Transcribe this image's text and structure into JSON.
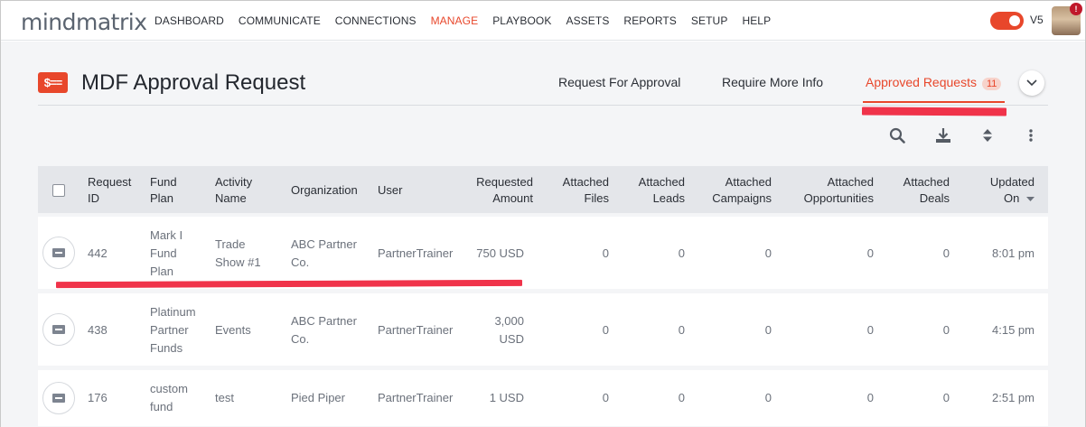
{
  "brand": {
    "logo_text": "mindmatrix"
  },
  "nav": {
    "items": [
      {
        "label": "DASHBOARD"
      },
      {
        "label": "COMMUNICATE"
      },
      {
        "label": "CONNECTIONS"
      },
      {
        "label": "MANAGE"
      },
      {
        "label": "PLAYBOOK"
      },
      {
        "label": "ASSETS"
      },
      {
        "label": "REPORTS"
      },
      {
        "label": "SETUP"
      },
      {
        "label": "HELP"
      }
    ],
    "active": "MANAGE",
    "version": "V5",
    "notification_count": "!"
  },
  "page": {
    "icon_text": "$==",
    "title": "MDF Approval Request"
  },
  "tabs": [
    {
      "label": "Request For Approval"
    },
    {
      "label": "Require More Info"
    },
    {
      "label": "Approved Requests",
      "count": "11"
    }
  ],
  "toolbar": {
    "icons": [
      "search-icon",
      "download-icon",
      "sort-icon",
      "more-vertical-icon"
    ]
  },
  "table": {
    "columns": [
      {
        "l1": "Request",
        "l2": "ID"
      },
      {
        "l1": "Fund",
        "l2": "Plan"
      },
      {
        "l1": "Activity",
        "l2": "Name"
      },
      {
        "l1": "Organization",
        "l2": ""
      },
      {
        "l1": "User",
        "l2": ""
      },
      {
        "l1": "Requested",
        "l2": "Amount"
      },
      {
        "l1": "Attached",
        "l2": "Files"
      },
      {
        "l1": "Attached",
        "l2": "Leads"
      },
      {
        "l1": "Attached",
        "l2": "Campaigns"
      },
      {
        "l1": "Attached",
        "l2": "Opportunities"
      },
      {
        "l1": "Attached",
        "l2": "Deals"
      },
      {
        "l1": "Updated",
        "l2": "On"
      }
    ],
    "rows": [
      {
        "id": "442",
        "fund": [
          "Mark I",
          "Fund",
          "Plan"
        ],
        "activity": [
          "Trade",
          "Show #1"
        ],
        "org": [
          "ABC Partner",
          "Co."
        ],
        "user": "PartnerTrainer",
        "amount": [
          "750 USD"
        ],
        "files": "0",
        "leads": "0",
        "campaigns": "0",
        "opportunities": "0",
        "deals": "0",
        "updated": "8:01 pm"
      },
      {
        "id": "438",
        "fund": [
          "Platinum",
          "Partner",
          "Funds"
        ],
        "activity": [
          "Events"
        ],
        "org": [
          "ABC Partner",
          "Co."
        ],
        "user": "PartnerTrainer",
        "amount": [
          "3,000",
          "USD"
        ],
        "files": "0",
        "leads": "0",
        "campaigns": "0",
        "opportunities": "0",
        "deals": "0",
        "updated": "4:15 pm"
      },
      {
        "id": "176",
        "fund": [
          "custom",
          "fund"
        ],
        "activity": [
          "test"
        ],
        "org": [
          "Pied Piper"
        ],
        "user": "PartnerTrainer",
        "amount": [
          "1 USD"
        ],
        "files": "0",
        "leads": "0",
        "campaigns": "0",
        "opportunities": "0",
        "deals": "0",
        "updated": "2:51 pm"
      }
    ]
  },
  "colors": {
    "accent": "#e8472b",
    "annotation": "#f0334a"
  }
}
